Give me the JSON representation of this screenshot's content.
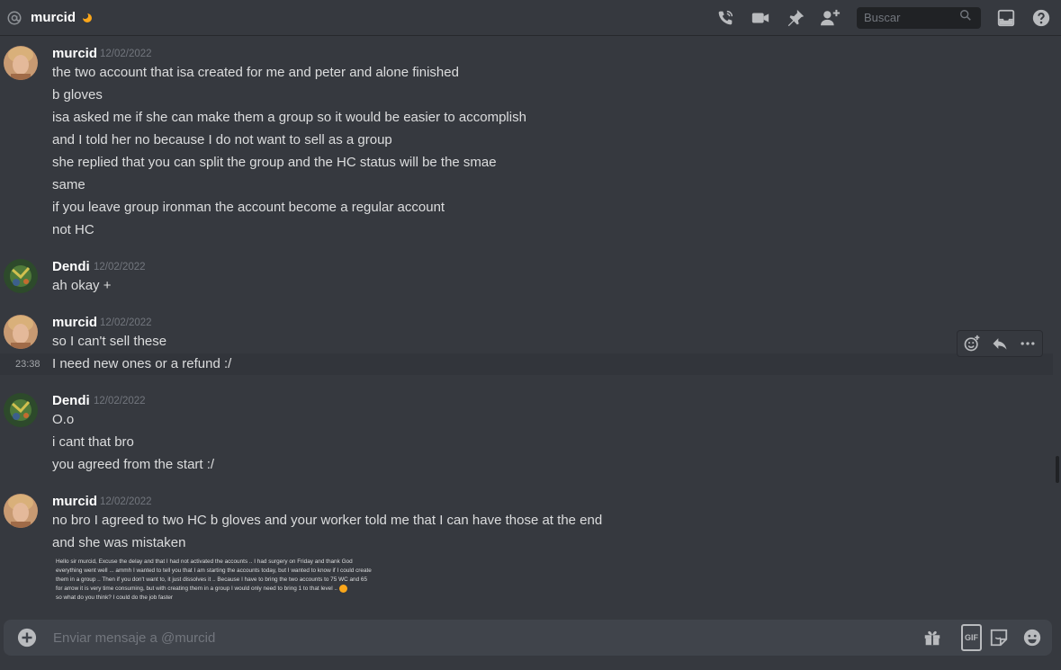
{
  "header": {
    "title": "murcid",
    "search_placeholder": "Buscar",
    "icons": [
      "at-icon",
      "moon-status-icon",
      "voice-call-icon",
      "video-call-icon",
      "pinned-messages-icon",
      "add-friend-icon",
      "search-icon",
      "inbox-icon",
      "help-icon"
    ]
  },
  "messages": [
    {
      "author": "murcid",
      "timestamp": "12/02/2022",
      "avatar": "murcid-avatar",
      "lines": [
        "the two account that isa created for me and peter and alone finished",
        "b gloves",
        "isa asked me if she can make them a group so it would be easier to accomplish",
        "and I told her no because I do not want to sell as a group",
        "she replied that you can split the group and the HC status will be the smae",
        "same",
        "if you leave group ironman the account become a regular account",
        "not HC"
      ]
    },
    {
      "author": "Dendi",
      "timestamp": "12/02/2022",
      "avatar": "dendi-avatar",
      "lines": [
        "ah okay +"
      ]
    },
    {
      "author": "murcid",
      "timestamp": "12/02/2022",
      "avatar": "murcid-avatar",
      "lines": [
        "so I can't sell these",
        "I need new ones or a refund :/"
      ],
      "hover_time": "23:38"
    },
    {
      "author": "Dendi",
      "timestamp": "12/02/2022",
      "avatar": "dendi-avatar",
      "lines": [
        "O.o",
        "i cant that bro",
        "you agreed from the start :/"
      ]
    },
    {
      "author": "murcid",
      "timestamp": "12/02/2022",
      "avatar": "murcid-avatar",
      "lines": [
        "no bro I agreed to two HC b gloves and your worker told me that I can have those at the end",
        "and she was mistaken"
      ],
      "attachment_lines": [
        "Hello sir murcid, Excuse the delay and that I had not activated the accounts .. I had surgery on Friday and thank God",
        "everything went well ... ammh I wanted to tell you that I am starting the accounts today, but I wanted to know if I could create",
        "them in a group .. Then if you don't want to, it just dissolves it .. Because I have to bring the two accounts to 75 WC and 65",
        "for arrow it is very time consuming, but with creating them in a group I would only need to bring 1 to that level ..",
        "so what do you think? I could do the job faster"
      ]
    }
  ],
  "composer": {
    "placeholder": "Enviar mensaje a @murcid",
    "gif_label": "GIF",
    "icons": [
      "add-attachment-icon",
      "gift-icon",
      "gif-icon",
      "sticker-icon",
      "emoji-icon"
    ]
  },
  "colors": {
    "background": "#36393f",
    "composer": "#40444b",
    "search": "#202225",
    "text": "#dcddde",
    "muted": "#72767d",
    "status_idle": "#faa61a"
  }
}
